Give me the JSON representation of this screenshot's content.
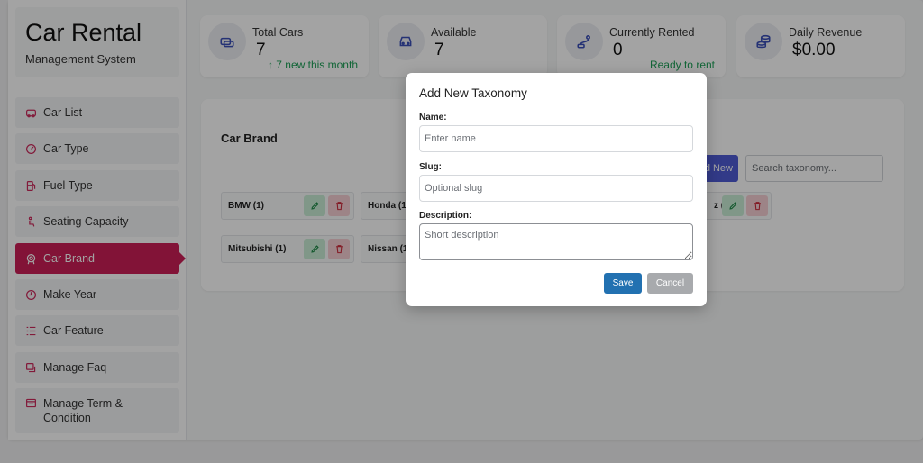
{
  "brand": {
    "title": "Car Rental",
    "subtitle": "Management System"
  },
  "sidebar": {
    "items": [
      {
        "label": "Car List",
        "icon": "car-list-icon"
      },
      {
        "label": "Car Type",
        "icon": "gauge-icon"
      },
      {
        "label": "Fuel Type",
        "icon": "fuel-pump-icon"
      },
      {
        "label": "Seating Capacity",
        "icon": "seat-icon"
      },
      {
        "label": "Car Brand",
        "icon": "brand-badge-icon",
        "active": true
      },
      {
        "label": "Make Year",
        "icon": "clock-icon"
      },
      {
        "label": "Car Feature",
        "icon": "feature-list-icon"
      },
      {
        "label": "Manage Faq",
        "icon": "faq-icon"
      },
      {
        "label": "Manage Term & Condition",
        "icon": "document-icon"
      }
    ]
  },
  "stats": [
    {
      "label": "Total Cars",
      "value": "7",
      "note": "↑ 7 new this month",
      "icon": "cars-icon"
    },
    {
      "label": "Available",
      "value": "7",
      "note": "",
      "icon": "car-front-icon"
    },
    {
      "label": "Currently Rented",
      "value": "0",
      "note": "Ready to rent",
      "icon": "route-icon"
    },
    {
      "label": "Daily Revenue",
      "value": "$0.00",
      "note": "",
      "icon": "coins-icon"
    }
  ],
  "colors": {
    "accent": "#cc1f56",
    "success": "#1b9e55",
    "primary": "#2271b1",
    "indigo": "#4f5bd5"
  },
  "panel": {
    "title": "Car Brand",
    "add_new_label": "d New",
    "search_placeholder": "Search taxonomy...",
    "items": [
      {
        "label": "BMW (1)"
      },
      {
        "label": "Honda (1)"
      },
      {
        "label": "z (1)"
      },
      {
        "label": "Mitsubishi (1)"
      },
      {
        "label": "Nissan (1)"
      }
    ]
  },
  "modal": {
    "title": "Add New Taxonomy",
    "name_label": "Name:",
    "name_placeholder": "Enter name",
    "slug_label": "Slug:",
    "slug_placeholder": "Optional slug",
    "description_label": "Description:",
    "description_placeholder": "Short description",
    "save_label": "Save",
    "cancel_label": "Cancel"
  }
}
